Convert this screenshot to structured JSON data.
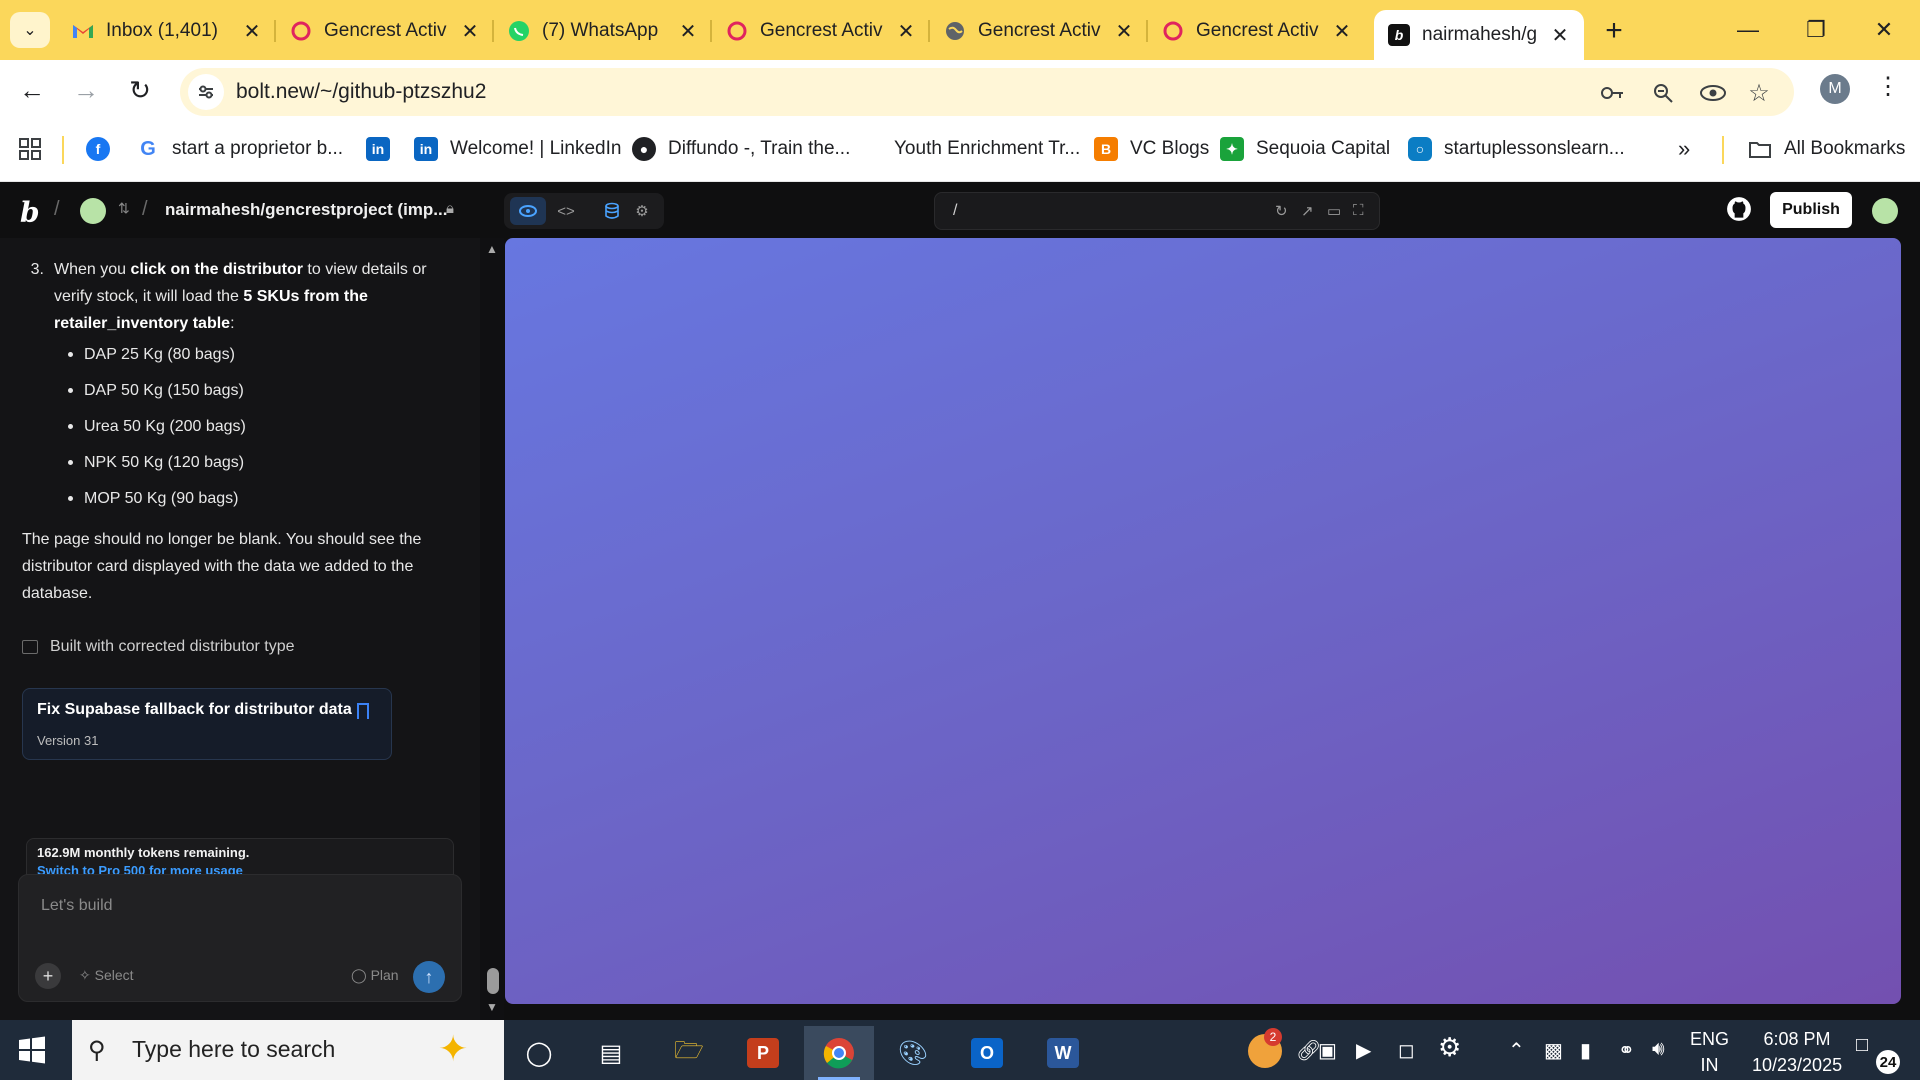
{
  "browser": {
    "tabs": [
      {
        "label": "Inbox (1,401)",
        "icon": "gmail-icon"
      },
      {
        "label": "Gencrest Activ",
        "icon": "opera-icon"
      },
      {
        "label": "(7) WhatsApp",
        "icon": "whatsapp-icon"
      },
      {
        "label": "Gencrest Activ",
        "icon": "opera-icon"
      },
      {
        "label": "Gencrest Activ",
        "icon": "globe-icon"
      },
      {
        "label": "Gencrest Activ",
        "icon": "opera-icon"
      },
      {
        "label": "nairmahesh/g",
        "icon": "bolt-icon",
        "active": true
      }
    ],
    "url": "bolt.new/~/github-ptzszhu2",
    "profile_initial": "M",
    "bookmarks": [
      {
        "label": "",
        "icon": "facebook-icon"
      },
      {
        "label": "start a proprietor b...",
        "icon": "google-icon"
      },
      {
        "label": "",
        "icon": "linkedin-icon"
      },
      {
        "label": "Welcome! | LinkedIn",
        "icon": "linkedin-icon"
      },
      {
        "label": "Diffundo -, Train the...",
        "icon": "globe-icon"
      },
      {
        "label": "Youth Enrichment Tr...",
        "icon": ""
      },
      {
        "label": "VC Blogs",
        "icon": "blogger-icon"
      },
      {
        "label": "Sequoia Capital",
        "icon": "sequoia-icon"
      },
      {
        "label": "startuplessonslearn...",
        "icon": "site-icon"
      }
    ],
    "overflow": "»",
    "all_bookmarks": "All Bookmarks"
  },
  "app": {
    "project_name": "nairmahesh/gencrestproject (imp...",
    "preview_path": "/",
    "publish_label": "Publish",
    "chat": {
      "step_number": "3.",
      "step_text_1": "When you ",
      "step_bold_1": "click on the distributor",
      "step_text_2": " to view details or verify stock, it will load the ",
      "step_bold_2": "5 SKUs from the retailer_inventory table",
      "step_text_3": ":",
      "skus": [
        "DAP 25 Kg (80 bags)",
        "DAP 50 Kg (150 bags)",
        "Urea 50 Kg (200 bags)",
        "NPK 50 Kg (120 bags)",
        "MOP 50 Kg (90 bags)"
      ],
      "summary": "The page should no longer be blank. You should see the distributor card displayed with the data we added to the database.",
      "build_status": "Built with corrected distributor type",
      "version_card": {
        "title": "Fix Supabase fallback for distributor data",
        "version": "Version 31"
      },
      "tokens_remaining": "162.9M monthly tokens remaining.",
      "upgrade_link": "Switch to Pro 500 for more usage",
      "composer_placeholder": "Let's build",
      "select_label": "Select",
      "plan_label": "Plan"
    }
  },
  "taskbar": {
    "search_placeholder": "Type here to search",
    "weather_badge": "2",
    "language_line1": "ENG",
    "language_line2": "IN",
    "time": "6:08 PM",
    "date": "10/23/2025",
    "notification_count": "24"
  },
  "colors": {
    "chrome_tabstrip": "#fbd75b",
    "app_bg": "#0f0f10",
    "preview_gradient_start": "#6777e0",
    "preview_gradient_end": "#7350b0",
    "accent_blue": "#3b82f6"
  }
}
